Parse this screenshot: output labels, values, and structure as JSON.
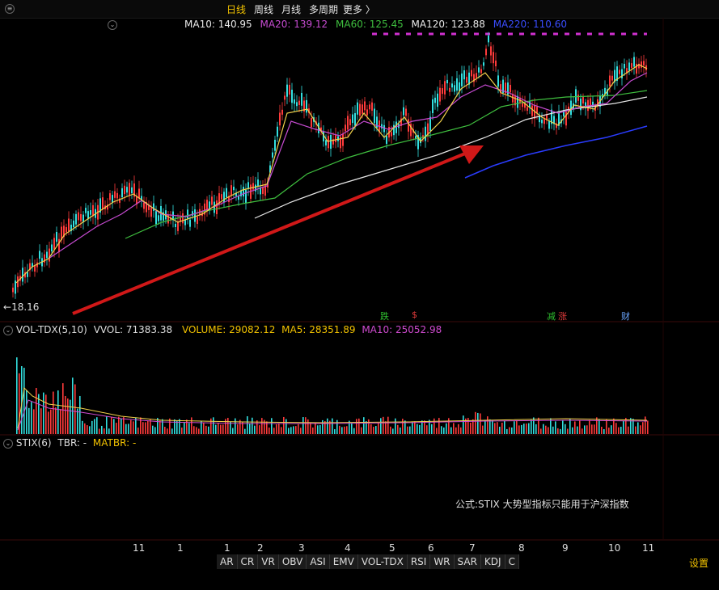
{
  "toolbar": {
    "periods": [
      "日线",
      "周线",
      "月线",
      "多周期",
      "更多 〉"
    ],
    "active_period": "日线"
  },
  "ma_legend": {
    "items": [
      {
        "label": "MA10: 140.95",
        "color": "#e8e8e8"
      },
      {
        "label": "MA20: 139.12",
        "color": "#c64bd1"
      },
      {
        "label": "MA60: 125.45",
        "color": "#3fbf3f"
      },
      {
        "label": "MA120: 123.88",
        "color": "#e8e8e8"
      },
      {
        "label": "MA220: 110.60",
        "color": "#3a4dff"
      }
    ]
  },
  "price_low_marker": "18.16",
  "event_badges": [
    {
      "text": "跌",
      "color": "#2fbf2f"
    },
    {
      "text": "$",
      "color": "#e23b3b"
    },
    {
      "text": "减",
      "color": "#2fbf2f"
    },
    {
      "text": "涨",
      "color": "#e23b3b"
    },
    {
      "text": "财",
      "color": "#6aa6ff"
    }
  ],
  "volume_pane": {
    "title": "VOL-TDX(5,10)",
    "vvol": "VVOL: 71383.38",
    "volume": "VOLUME: 29082.12",
    "ma5": "MA5: 28351.89",
    "ma10": "MA10: 25052.98"
  },
  "stix_pane": {
    "title": "STIX(6)",
    "tbr": "TBR: -",
    "matbr": "MATBR: -",
    "note": "公式:STIX 大势型指标只能用于沪深指数"
  },
  "x_axis_labels": [
    "11",
    "1",
    "1",
    "2",
    "3",
    "4",
    "5",
    "6",
    "7",
    "8",
    "9",
    "10",
    "11"
  ],
  "indicator_tabs": [
    "AR",
    "CR",
    "VR",
    "OBV",
    "ASI",
    "EMV",
    "VOL-TDX",
    "RSI",
    "WR",
    "SAR",
    "KDJ",
    "C"
  ],
  "settings_label": "设置",
  "colors": {
    "up": "#ff3b3b",
    "down": "#33e0e0",
    "ma5": "#ffffff",
    "ma10": "#f2d24b",
    "arrow": "#d01818"
  }
}
